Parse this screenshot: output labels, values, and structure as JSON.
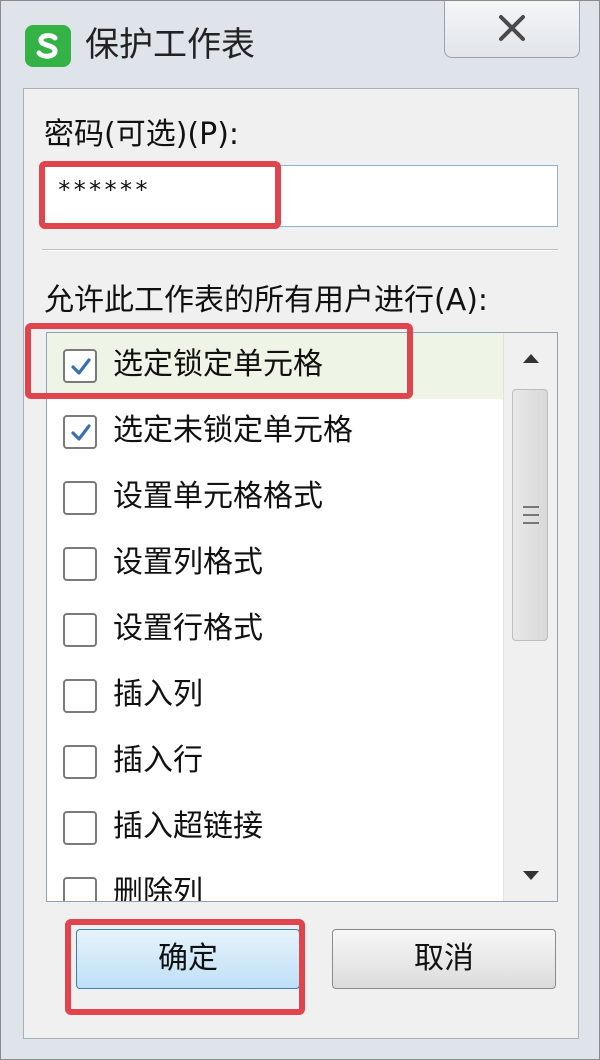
{
  "window": {
    "title": "保护工作表",
    "close_icon": "close-icon",
    "app_icon": "wps-spreadsheet-icon",
    "app_icon_color": "#34b245"
  },
  "password": {
    "label": "密码(可选)(P):",
    "value": "******"
  },
  "permissions": {
    "label": "允许此工作表的所有用户进行(A):",
    "items": [
      {
        "label": "选定锁定单元格",
        "checked": true
      },
      {
        "label": "选定未锁定单元格",
        "checked": true
      },
      {
        "label": "设置单元格格式",
        "checked": false
      },
      {
        "label": "设置列格式",
        "checked": false
      },
      {
        "label": "设置行格式",
        "checked": false
      },
      {
        "label": "插入列",
        "checked": false
      },
      {
        "label": "插入行",
        "checked": false
      },
      {
        "label": "插入超链接",
        "checked": false
      },
      {
        "label": "删除列",
        "checked": false
      }
    ]
  },
  "buttons": {
    "ok": "确定",
    "cancel": "取消"
  },
  "colors": {
    "highlight_box": "#e0454e",
    "ok_button": "#bfe0f7"
  }
}
